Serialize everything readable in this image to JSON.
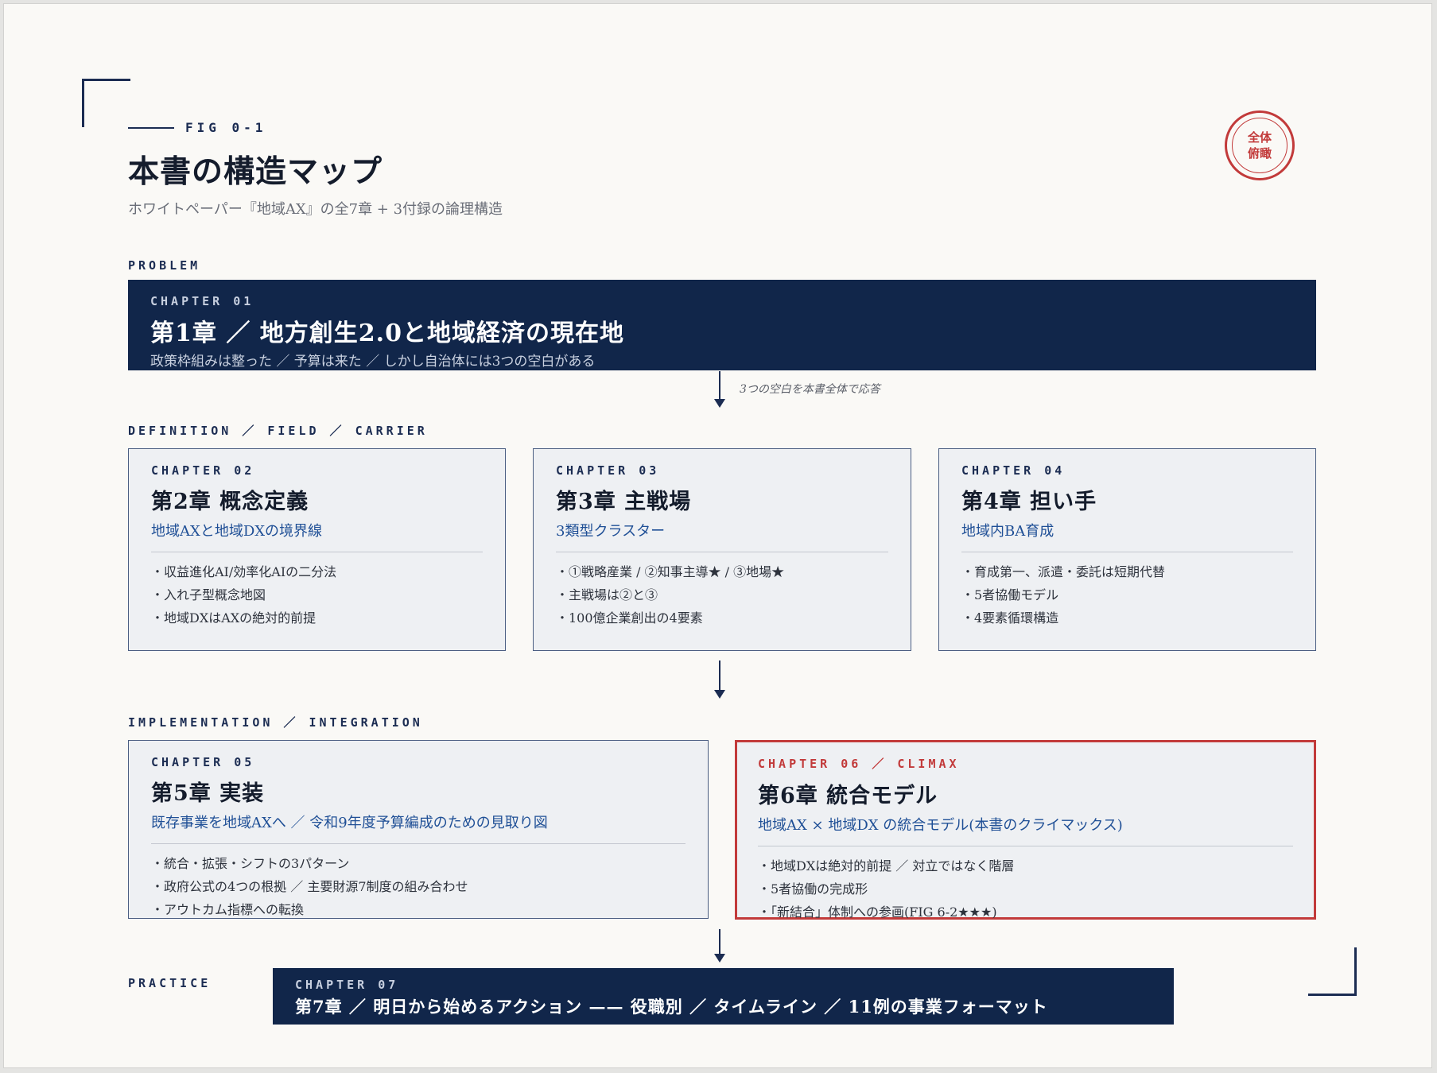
{
  "figure": {
    "label": "FIG 0-1",
    "title": "本書の構造マップ",
    "subtitle": "ホワイトペーパー『地域AX』の全7章 + 3付録の論理構造"
  },
  "stamp": {
    "line1": "全体",
    "line2": "俯瞰"
  },
  "sections": {
    "problem": "PROBLEM",
    "definition": "DEFINITION ／ FIELD ／ CARRIER",
    "implementation": "IMPLEMENTATION ／ INTEGRATION",
    "practice": "PRACTICE"
  },
  "chapter1": {
    "kicker": "CHAPTER 01",
    "title": "第1章 ／ 地方創生2.0と地域経済の現在地",
    "subtitle": "政策枠組みは整った ／ 予算は来た ／ しかし自治体には3つの空白がある"
  },
  "arrow_note": "3つの空白を本書全体で応答",
  "chapter2": {
    "kicker": "CHAPTER 02",
    "title": "第2章 概念定義",
    "subtitle": "地域AXと地域DXの境界線",
    "items": [
      "・収益進化AI/効率化AIの二分法",
      "・入れ子型概念地図",
      "・地域DXはAXの絶対的前提"
    ]
  },
  "chapter3": {
    "kicker": "CHAPTER 03",
    "title": "第3章 主戦場",
    "subtitle": "3類型クラスター",
    "items": [
      "・①戦略産業 / ②知事主導★ / ③地場★",
      "・主戦場は②と③",
      "・100億企業創出の4要素"
    ]
  },
  "chapter4": {
    "kicker": "CHAPTER 04",
    "title": "第4章 担い手",
    "subtitle": "地域内BA育成",
    "items": [
      "・育成第一、派遣・委託は短期代替",
      "・5者協働モデル",
      "・4要素循環構造"
    ]
  },
  "chapter5": {
    "kicker": "CHAPTER 05",
    "title": "第5章 実装",
    "subtitle": "既存事業を地域AXへ ／ 令和9年度予算編成のための見取り図",
    "items": [
      "・統合・拡張・シフトの3パターン",
      "・政府公式の4つの根拠 ／ 主要財源7制度の組み合わせ",
      "・アウトカム指標への転換"
    ]
  },
  "chapter6": {
    "kicker": "CHAPTER 06 ／ CLIMAX",
    "title": "第6章 統合モデル",
    "subtitle": "地域AX × 地域DX の統合モデル(本書のクライマックス)",
    "items": [
      "・地域DXは絶対的前提 ／ 対立ではなく階層",
      "・5者協働の完成形",
      "・「新結合」体制への参画(FIG 6-2★★★)"
    ]
  },
  "chapter7": {
    "kicker": "CHAPTER 07",
    "title": "第7章 ／ 明日から始めるアクション —— 役職別 ／ タイムライン ／ 11例の事業フォーマット"
  },
  "colors": {
    "navy": "#11264a",
    "accent_red": "#c23a3a",
    "link_blue": "#1f4f96",
    "card_bg": "#eef0f3",
    "page_bg": "#faf9f6"
  }
}
